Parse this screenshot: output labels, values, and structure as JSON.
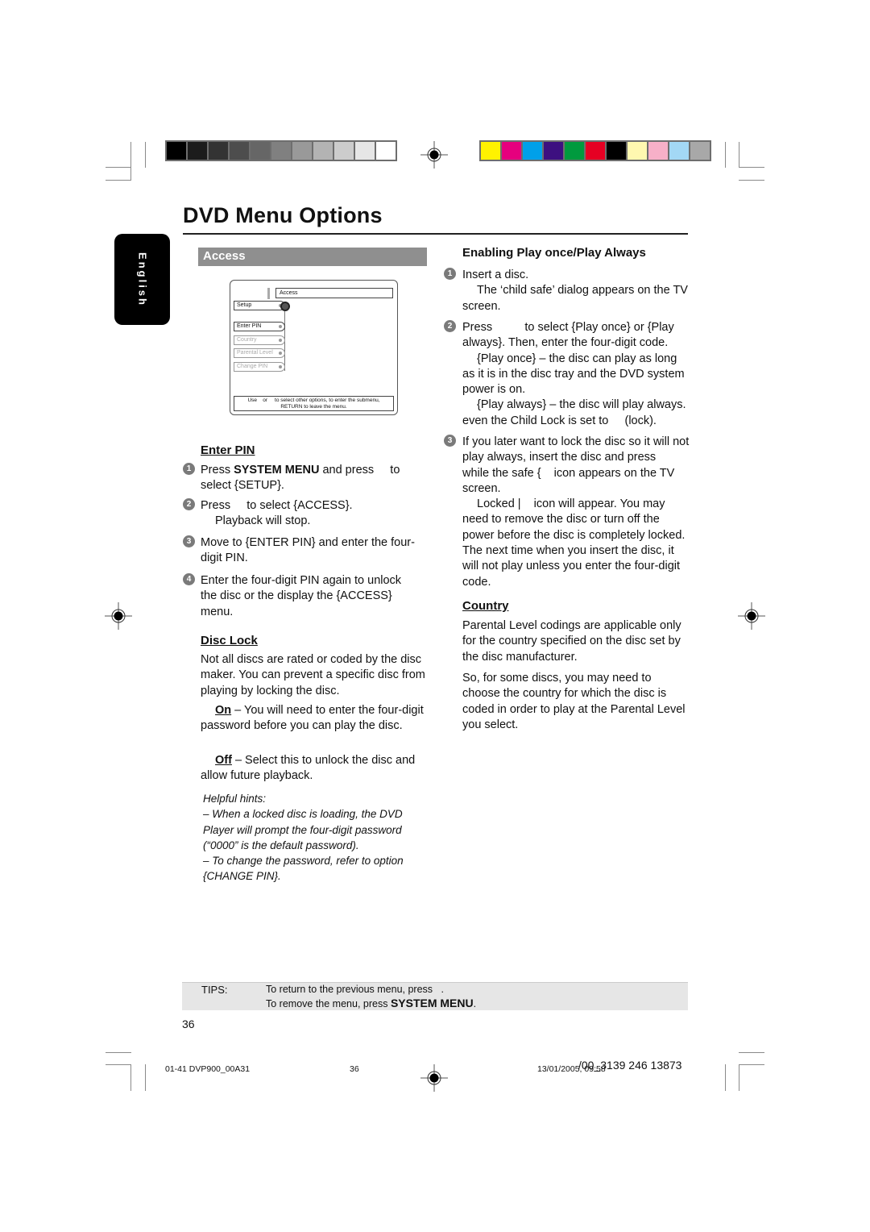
{
  "print_marks": {
    "grayscale_swatches": [
      "#000000",
      "#1c1c1c",
      "#333333",
      "#4d4d4d",
      "#666666",
      "#808080",
      "#999999",
      "#b3b3b3",
      "#cccccc",
      "#e6e6e6",
      "#ffffff"
    ],
    "color_swatches": [
      "#fff200",
      "#e6007e",
      "#00a0e9",
      "#3d1080",
      "#009a3e",
      "#e60023",
      "#000000",
      "#fff8b0",
      "#f7b0c8",
      "#a3d8f5",
      "#a8a8a8"
    ]
  },
  "header": {
    "title": "DVD Menu Options",
    "language_tab": "English"
  },
  "left": {
    "section_title": "Access",
    "osd": {
      "header": "Access",
      "root_item": "Setup",
      "items": [
        {
          "label": "Enter PIN",
          "enabled": true
        },
        {
          "label": "Country",
          "enabled": false
        },
        {
          "label": "Parental Level",
          "enabled": false
        },
        {
          "label": "Change PIN",
          "enabled": false
        }
      ],
      "footer_line1": "Use    or     to select other options, to enter the submenu,",
      "footer_line2": "RETURN to leave the menu."
    },
    "enter_pin": {
      "heading": "Enter PIN",
      "steps": [
        {
          "num": "1",
          "pre": "Press ",
          "bold": "SYSTEM MENU",
          "post": " and press     to select {SETUP}."
        },
        {
          "num": "2",
          "text": "Press     to select {ACCESS}.",
          "note": "Playback will stop."
        },
        {
          "num": "3",
          "text": "Move to {ENTER PIN} and enter the four-digit PIN."
        },
        {
          "num": "4",
          "text": "Enter the four-digit PIN again to unlock the disc or the display the {ACCESS} menu."
        }
      ]
    },
    "disc_lock": {
      "heading": "Disc Lock",
      "intro": "Not all discs are rated or coded by the disc maker. You can prevent a specific disc from playing by locking the disc.",
      "on_label": "On",
      "on_text": " – You will need to enter the four-digit password before you can play the disc.",
      "off_label": "Off",
      "off_text": " – Select this to unlock the disc and allow future playback."
    },
    "hints": {
      "title": "Helpful hints:",
      "lines": [
        "– When a locked disc is loading, the DVD",
        "Player will prompt the four-digit password",
        "(“0000” is the default password).",
        "– To change the password, refer to option",
        "{CHANGE PIN}."
      ]
    }
  },
  "right": {
    "play_always": {
      "heading": "Enabling Play once/Play Always",
      "step1": "Insert a disc.",
      "step1_note": "The ‘child safe’ dialog appears on the TV screen.",
      "step2": "Press          to select {Play once} or {Play always}. Then, enter the four-digit code.",
      "step2_once": "{Play once} – the disc can play as long as it is in the disc tray and the DVD system power is on.",
      "step2_always": "{Play always} – the disc will play always. even the Child Lock is set to     (lock).",
      "step3": "If you later want to lock the disc so it will not play always, insert the disc and press      while the safe {    icon appears on the TV screen.",
      "step3_note": "Locked |    icon will appear. You may need to remove the disc or turn off the power before the disc is completely locked. The next time when you insert the disc, it will not play unless you enter the four-digit code."
    },
    "country": {
      "heading": "Country",
      "para1": "Parental Level codings are applicable only for the country specified on the disc set by the disc manufacturer.",
      "para2": "So, for some discs, you may need to choose the country for which the disc is coded in order to play at the Parental Level you select."
    }
  },
  "tips": {
    "label": "TIPS:",
    "line1": "To return to the previous menu, press   .",
    "line2_pre": "To remove the menu, press ",
    "line2_bold": "SYSTEM MENU",
    "line2_post": "."
  },
  "page_number": "36",
  "footer": {
    "file": "01-41 DVP900_00A31",
    "page": "36",
    "date": "13/01/2005, 09:58",
    "code": "/00_3139 246 13873"
  }
}
